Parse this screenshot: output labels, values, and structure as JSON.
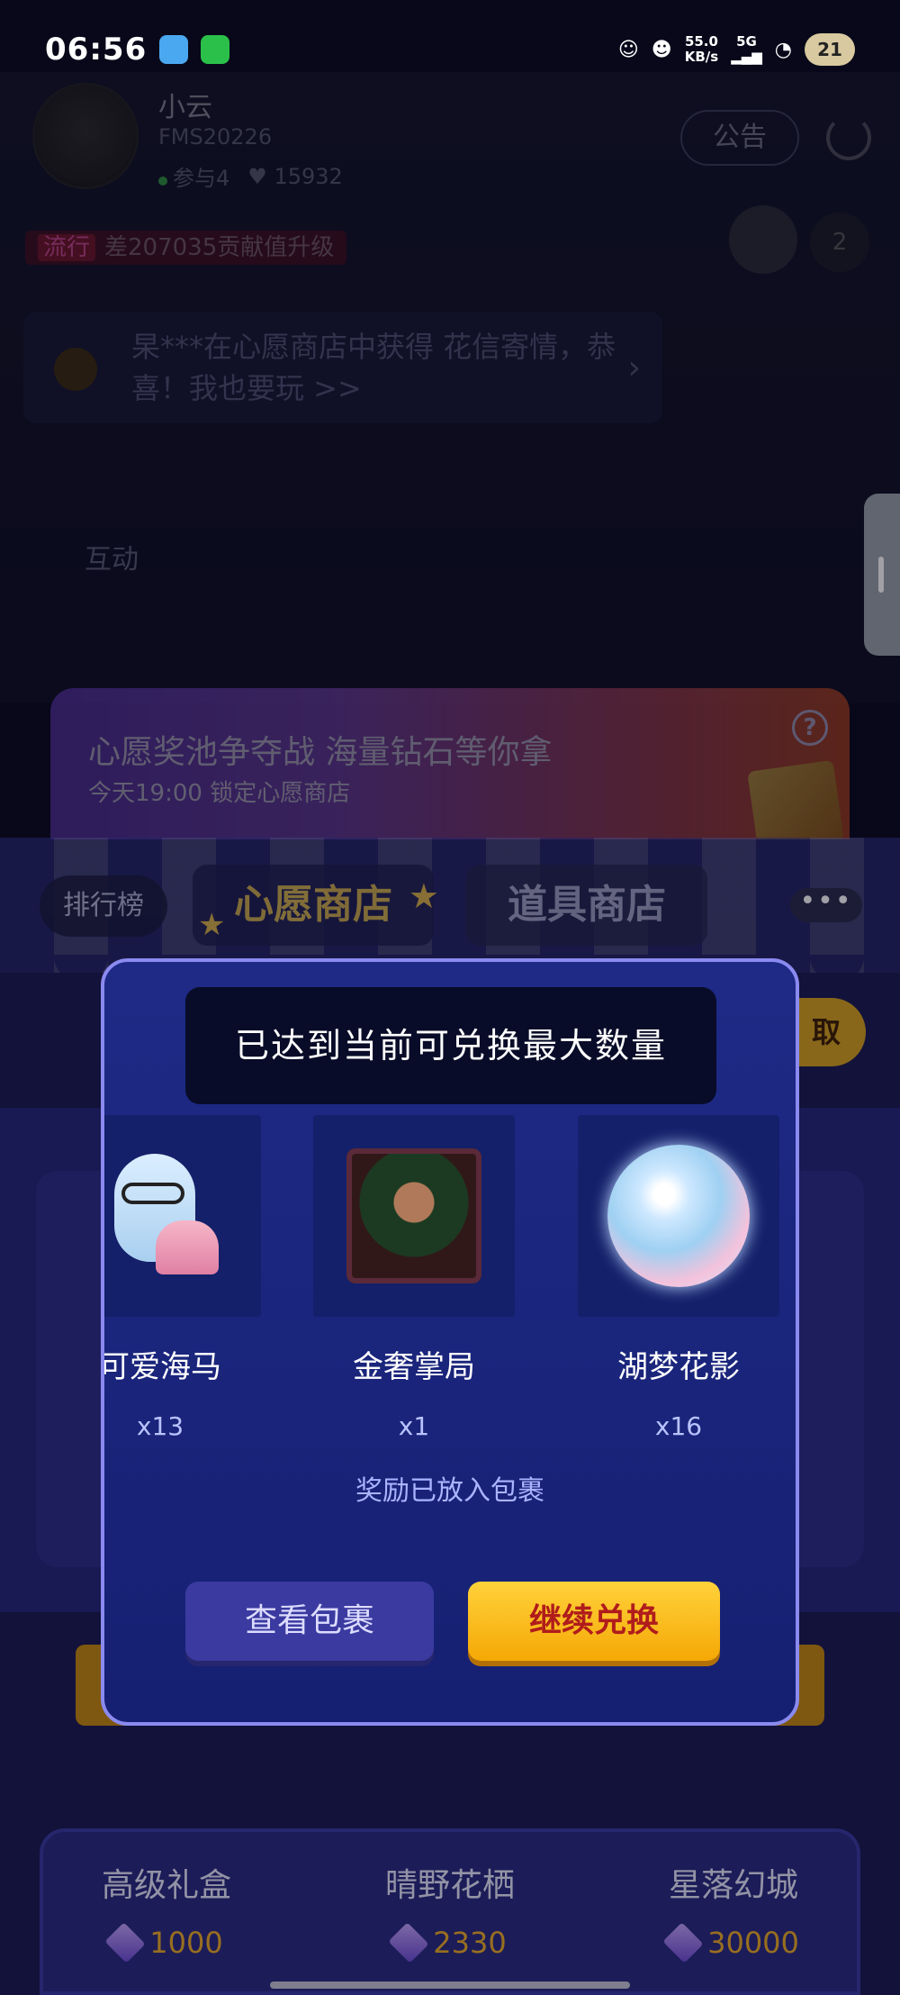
{
  "status_bar": {
    "time": "06:56",
    "net_speed": "55.0",
    "net_unit": "KB/s",
    "network": "5G",
    "battery": "21",
    "icons": [
      "app-notification-icon",
      "wechat-icon",
      "game-icon",
      "cat-icon",
      "signal-icon",
      "wifi-icon",
      "battery-icon"
    ]
  },
  "room": {
    "host_name": "小云",
    "host_id": "FMS20226",
    "host_stats": [
      "参与4",
      "15932"
    ],
    "notice_button": "公告",
    "online_count": "2",
    "level_tag": "流行",
    "level_text": "差207035贡献值升级",
    "message": "杲***在心愿商店中获得 花信寄情，恭喜！我也要玩 >>",
    "interact_label": "互动"
  },
  "promo": {
    "title": "心愿奖池争夺战 海量钻石等你拿",
    "subtitle": "今天19:00 锁定心愿商店",
    "help": "?"
  },
  "shop_tabs": {
    "ranking": "排行榜",
    "wish_shop": "心愿商店",
    "item_shop": "道具商店",
    "more": "•••"
  },
  "claim_label": "取",
  "modal": {
    "toast": "已达到当前可兑换最大数量",
    "prizes": [
      {
        "name": "可爱海马",
        "qty": "x13",
        "icon": "seahorse-icon"
      },
      {
        "name": "金奢掌局",
        "qty": "x1",
        "icon": "gentleman-portrait-icon"
      },
      {
        "name": "湖梦花影",
        "qty": "x16",
        "icon": "flower-orb-icon"
      }
    ],
    "reward_note": "奖励已放入包裹",
    "view_button": "查看包裹",
    "continue_button": "继续兑换"
  },
  "bottom_gifts": [
    {
      "name": "高级礼盒",
      "price": "1000"
    },
    {
      "name": "晴野花栖",
      "price": "2330"
    },
    {
      "name": "星落幻城",
      "price": "30000"
    }
  ],
  "colors": {
    "modal_bg": "#1e2a86",
    "modal_border": "#8a8af0",
    "continue_button": "#ffc21a",
    "continue_text": "#b01c1c",
    "price": "#f3b028"
  }
}
